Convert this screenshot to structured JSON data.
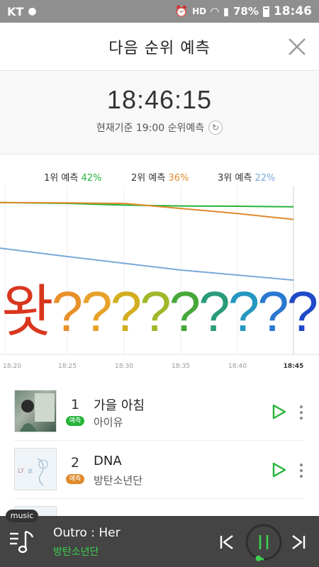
{
  "status_bar": {
    "carrier": "KT",
    "battery": "78%",
    "time": "18:46"
  },
  "header": {
    "title": "다음 순위 예측"
  },
  "time_panel": {
    "clock": "18:46:15",
    "basis": "현재기준 19:00 순위예측"
  },
  "legend": [
    {
      "label": "1위 예측",
      "pct": "42%",
      "color": "#25b33a"
    },
    {
      "label": "2위 예측",
      "pct": "36%",
      "color": "#e08a2c"
    },
    {
      "label": "3위 예측",
      "pct": "22%",
      "color": "#7aa9d8"
    }
  ],
  "overlay": {
    "chars": [
      "왓",
      "?",
      "?",
      "?",
      "?",
      "?",
      "?",
      "?",
      "?",
      "?"
    ],
    "colors": [
      "#d9361e",
      "#e8902a",
      "#e8a22a",
      "#d2ad1f",
      "#9fb82a",
      "#46a83a",
      "#2a9b7a",
      "#2597c0",
      "#2a78d0",
      "#1f49c8"
    ]
  },
  "chart_data": {
    "type": "line",
    "x": [
      "18:20",
      "18:25",
      "18:30",
      "18:35",
      "18:40",
      "18:45"
    ],
    "series": [
      {
        "name": "1위 예측",
        "color": "#25b33a",
        "values": [
          90,
          89.5,
          88.5,
          88,
          87.8,
          87.5
        ]
      },
      {
        "name": "2위 예측",
        "color": "#e08a2c",
        "values": [
          90,
          89.8,
          89.5,
          86.5,
          83.5,
          80
        ]
      },
      {
        "name": "3위 예측",
        "color": "#7aa9d8",
        "values": [
          63,
          58,
          54,
          50,
          47,
          44
        ]
      }
    ],
    "ylim": [
      0,
      100
    ],
    "grid": true
  },
  "songs": [
    {
      "rank": "1",
      "badge": "예측",
      "badge_color": "#25b33a",
      "title": "가을 아침",
      "artist": "아이유"
    },
    {
      "rank": "2",
      "badge": "예측",
      "badge_color": "#e08a2c",
      "title": "DNA",
      "artist": "방탄소년단"
    }
  ],
  "player": {
    "tab": "music",
    "title": "Outro : Her",
    "artist": "방탄소년단",
    "progress": 0.05
  }
}
